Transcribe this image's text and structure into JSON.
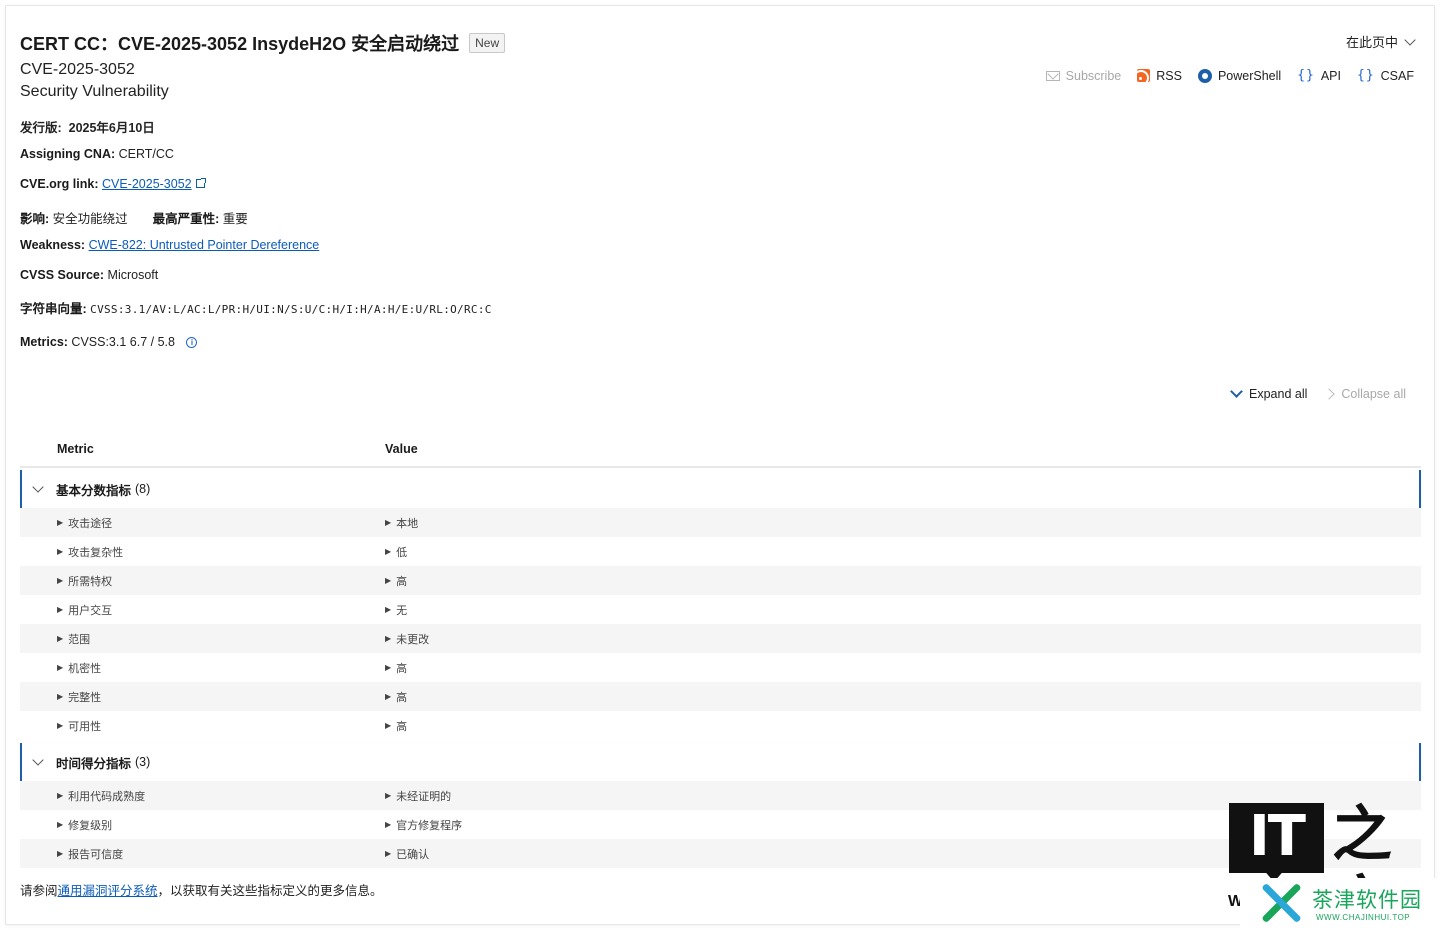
{
  "header": {
    "title": "CERT CC：CVE-2025-3052 InsydeH2O 安全启动绕过",
    "new_badge": "New",
    "cve_id": "CVE-2025-3052",
    "type": "Security Vulnerability",
    "on_this_page": "在此页中"
  },
  "toolbar": {
    "subscribe": "Subscribe",
    "rss": "RSS",
    "powershell": "PowerShell",
    "api": "API",
    "csaf": "CSAF"
  },
  "details": {
    "release_label": "发行版:",
    "release_date": "2025年6月10日",
    "cna_label": "Assigning CNA:",
    "cna_value": "CERT/CC",
    "cveorg_label": "CVE.org link:",
    "cveorg_link": "CVE-2025-3052",
    "impact_label": "影响:",
    "impact_value": "安全功能绕过",
    "severity_label": "最高严重性:",
    "severity_value": "重要",
    "weakness_label": "Weakness:",
    "weakness_link": "CWE-822: Untrusted Pointer Dereference",
    "cvss_source_label": "CVSS Source:",
    "cvss_source_value": "Microsoft",
    "vector_label": "字符串向量:",
    "vector_value": "CVSS:3.1/AV:L/AC:L/PR:H/UI:N/S:U/C:H/I:H/A:H/E:U/RL:O/RC:C",
    "metrics_label": "Metrics:",
    "metrics_value": "CVSS:3.1 6.7 / 5.8"
  },
  "controls": {
    "expand_all": "Expand all",
    "collapse_all": "Collapse all"
  },
  "table": {
    "col_metric": "Metric",
    "col_value": "Value",
    "groups": [
      {
        "name": "基本分数指标",
        "count": "(8)",
        "rows": [
          {
            "metric": "攻击途径",
            "value": "本地"
          },
          {
            "metric": "攻击复杂性",
            "value": "低"
          },
          {
            "metric": "所需特权",
            "value": "高"
          },
          {
            "metric": "用户交互",
            "value": "无"
          },
          {
            "metric": "范围",
            "value": "未更改"
          },
          {
            "metric": "机密性",
            "value": "高"
          },
          {
            "metric": "完整性",
            "value": "高"
          },
          {
            "metric": "可用性",
            "value": "高"
          }
        ]
      },
      {
        "name": "时间得分指标",
        "count": "(3)",
        "rows": [
          {
            "metric": "利用代码成熟度",
            "value": "未经证明的"
          },
          {
            "metric": "修复级别",
            "value": "官方修复程序"
          },
          {
            "metric": "报告可信度",
            "value": "已确认"
          }
        ]
      }
    ]
  },
  "footnote": {
    "prefix": "请参阅",
    "link": "通用漏洞评分系统",
    "suffix": "，以获取有关这些指标定义的更多信息。"
  },
  "watermarks": {
    "it_logo": "IT",
    "it_home": "之家",
    "w": "W",
    "chajinhui_title": "茶津软件园",
    "chajinhui_url": "WWW.CHAJINHUI.TOP"
  },
  "colors": {
    "accent": "#1f5fa8",
    "link": "#0b5cb8",
    "rss": "#f26522",
    "watermark_green": "#19a55a"
  }
}
